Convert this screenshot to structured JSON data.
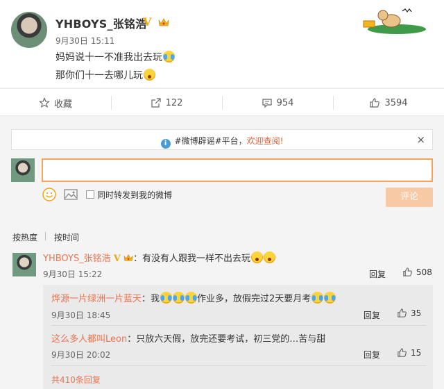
{
  "post": {
    "username": "YHBOYS_张铭浩",
    "verified_mark": "V",
    "timestamp": "9月30日 15:11",
    "line1": "妈妈说十一不准我出去玩",
    "line2": "那你们十一去哪儿玩"
  },
  "actions": {
    "favorite_label": "收藏",
    "share_count": "122",
    "comment_count": "954",
    "like_count": "3594"
  },
  "notice": {
    "prefix": "#微博辟谣#平台，",
    "highlight": "欢迎查阅!",
    "close": "×"
  },
  "composer": {
    "input_value": "",
    "repost_label": "同时转发到我的微博",
    "submit_label": "评论"
  },
  "sort": {
    "hot": "按热度",
    "time": "按时间"
  },
  "comment": {
    "username": "YHBOYS_张铭浩",
    "verified_mark": "V",
    "text": "：有没有人跟我一样不出去玩",
    "time": "9月30日 15:22",
    "reply": "回复",
    "likes": "508"
  },
  "replies": [
    {
      "username": "烨源一片绿洲一片蓝天",
      "text_a": "：我",
      "text_b": "作业多，放假完过2天要月考",
      "time": "9月30日 18:45",
      "reply": "回复",
      "likes": "35"
    },
    {
      "username": "这么多人都叫Leon",
      "text_a": "：只放六天假，放完还要考试，初三党的…苦与甜",
      "text_b": "",
      "time": "9月30日 20:02",
      "reply": "回复",
      "likes": "15"
    }
  ],
  "more_replies": "共410条回复",
  "icons": [
    "star-icon",
    "share-icon",
    "comment-icon",
    "thumb-up-icon",
    "info-icon",
    "close-icon",
    "smile-icon",
    "image-icon",
    "crown-icon",
    "cry-laugh-emoji",
    "shock-emoji"
  ],
  "colors": {
    "accent": "#eb7350",
    "input_border": "#f8a25e",
    "button_disabled": "#f7c9a4",
    "verified": "#f2a50c"
  }
}
